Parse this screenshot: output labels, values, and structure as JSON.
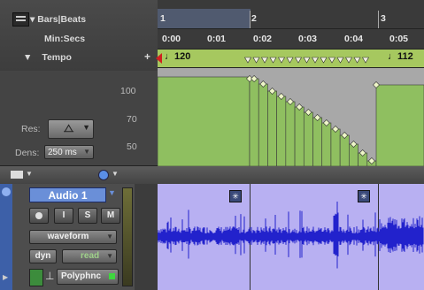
{
  "rulers": {
    "bars_beats_label": "Bars|Beats",
    "min_secs_label": "Min:Secs",
    "tempo_label": "Tempo",
    "add_tempo_symbol": "+",
    "bar_numbers": [
      "1",
      "2",
      "3"
    ],
    "time_marks": [
      "0:00",
      "0:01",
      "0:02",
      "0:03",
      "0:04",
      "0:05"
    ],
    "tempo_events": [
      {
        "note": "♩",
        "value": "120"
      },
      {
        "note": "♩",
        "value": "112"
      }
    ]
  },
  "tempo_editor": {
    "scale": [
      "100",
      "70",
      "50"
    ],
    "res_label": "Res:",
    "dens_label": "Dens:",
    "dens_value": "250 ms"
  },
  "track": {
    "name": "Audio 1",
    "rec_label": "",
    "input_label": "I",
    "solo_label": "S",
    "mute_label": "M",
    "view_mode": "waveform",
    "automation_label": "dyn",
    "automation_mode": "read",
    "plugin_name": "Polyphnc"
  },
  "colors": {
    "tempo_fill": "#8fbf60",
    "waveform_bg": "#b8b0f2",
    "waveform": "#2222cc",
    "ruler_green": "#a6c85f",
    "track_name_bg": "#6a8fd8"
  }
}
